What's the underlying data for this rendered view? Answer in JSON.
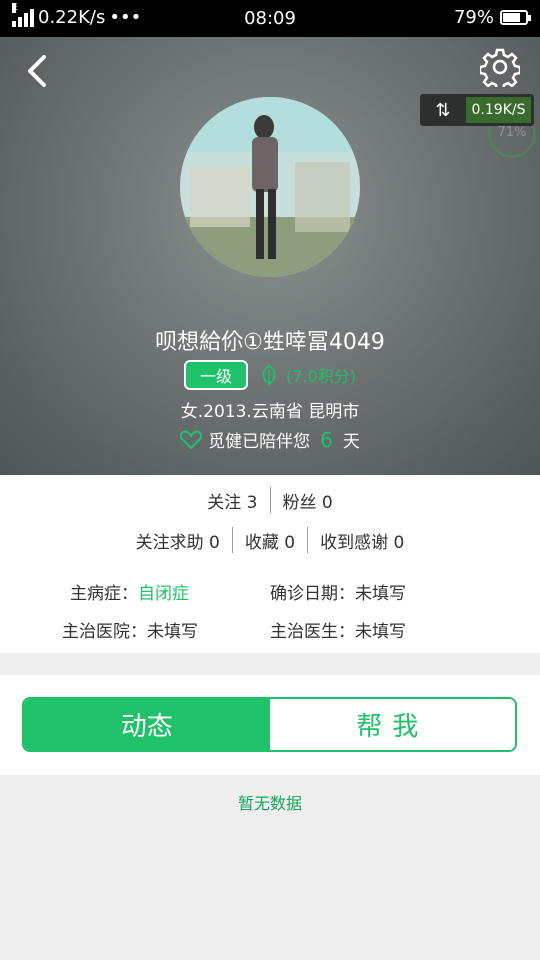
{
  "status_bar": {
    "network": "0.22K/s",
    "dots": "•••",
    "time": "08:09",
    "battery": "79%",
    "signal_type": "E"
  },
  "header": {
    "speed_badge": "0.19K/S",
    "ghost_percent": "71%",
    "username": "呗想給伱①甡啈冨4049",
    "level": "一级",
    "points": "(7.0积分)",
    "info": "女.2013.云南省 昆明市",
    "days_prefix": "觅健已陪伴您",
    "days_count": "6",
    "days_suffix": "天"
  },
  "stats": {
    "follow": "关注 3",
    "fans": "粉丝 0",
    "help": "关注求助 0",
    "favorites": "收藏 0",
    "thanks": "收到感谢 0"
  },
  "details": {
    "disease_label": "主病症：",
    "disease_value": "自闭症",
    "diagnosis_date": "确诊日期：未填写",
    "hospital": "主治医院：未填写",
    "doctor": "主治医生：未填写"
  },
  "tabs": {
    "active": "动态",
    "inactive": "帮我"
  },
  "empty_text": "暂无数据",
  "colors": {
    "accent": "#1fc16a"
  },
  "icons": {
    "back": "chevron-left-icon",
    "settings": "gear-icon",
    "swap": "swap-arrows-icon",
    "heart": "heart-icon",
    "points": "leaf-icon"
  }
}
